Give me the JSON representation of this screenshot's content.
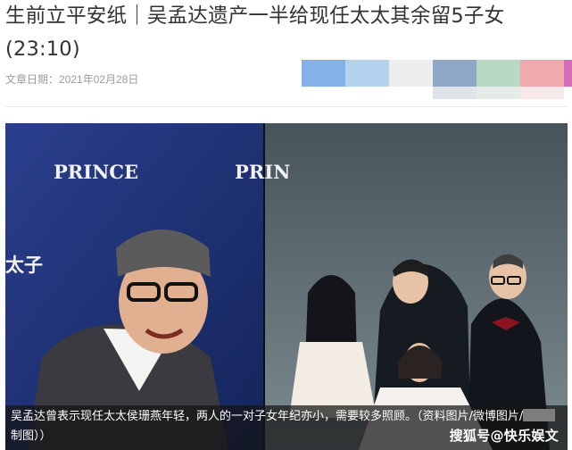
{
  "article": {
    "title": "生前立平安纸｜吴孟达遗产一半给现任太太其余留5子女(23:10)",
    "meta_label": "文章日期：",
    "date": "2021年02月28日"
  },
  "photo": {
    "logo_left": "PRINCE",
    "logo_left_cn": "太子",
    "logo_right": "PRIN",
    "caption_part1": "吴孟达曾表示现任太太侯珊燕年轻，两人的一对子女年纪亦小，需要较多照顾。（资料图片/微博图片/",
    "caption_part2": "制图））",
    "watermark": "搜狐号@快乐娱文"
  },
  "colors": {
    "swatches": [
      "#83b3e6",
      "#b5d3f0",
      "#eeeeee",
      "#8fa6c6",
      "#b9d9c4",
      "#f1a9b0",
      "#d96bbd"
    ],
    "swatches_under": [
      "#ffffff",
      "#ffffff",
      "#ffffff",
      "#dfe3ea",
      "#e4ece7",
      "#f7e8ea",
      "#ffffff"
    ]
  }
}
